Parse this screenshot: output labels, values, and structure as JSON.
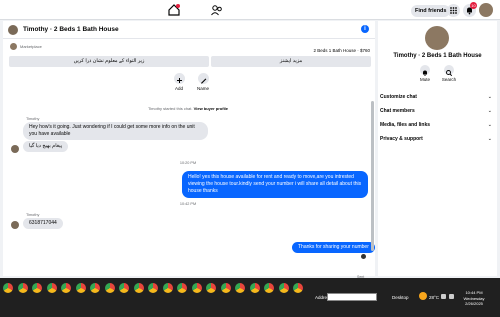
{
  "topnav": {
    "find_friends": "Find friends",
    "notification_count": "10"
  },
  "chat": {
    "contact": "Timothy · 2 Beds 1 Bath House",
    "marketplace_label": "Marketplace",
    "listing_summary": "2 Beds 1 Bath House · $760",
    "option_left": "زیر التواء کے معلوم نشان ذرا کریں",
    "option_right": "مزید اپشنز",
    "actions": [
      {
        "label": "Add",
        "icon": "plus-icon"
      },
      {
        "label": "Name",
        "icon": "pencil-icon"
      }
    ],
    "system_text": "Timothy started this chat.",
    "system_link": "View buyer profile",
    "messages": [
      {
        "sender": "Timothy",
        "text": "Hey how's it going. Just wondering if I could get some more info on the unit you have available",
        "direction": "in"
      },
      {
        "text": "پیغام بھیج دیا گیا",
        "direction": "in"
      },
      {
        "time": "10:20 PM"
      },
      {
        "text": "Hello! yes this house available for rent and ready to move,are you intrested viewing the house tour.kindly send your number i will share all detail about this house thanks",
        "direction": "out"
      },
      {
        "time": "10:42 PM"
      },
      {
        "sender": "Timothy",
        "text": "6318717044",
        "direction": "in"
      },
      {
        "text": "Thanks for sharing your number",
        "direction": "out"
      }
    ],
    "sent_status": "Sent",
    "composer_placeholder": "Aa"
  },
  "rpanel": {
    "name": "Timothy · 2 Beds 1 Bath House",
    "actions": [
      {
        "label": "Mute",
        "icon": "bell-icon"
      },
      {
        "label": "Search",
        "icon": "search-icon"
      }
    ],
    "sections": [
      "Customize chat",
      "Chat members",
      "Media, files and links",
      "Privacy & support"
    ]
  },
  "taskbar": {
    "address_label": "Address",
    "desktop_label": "Desktop",
    "temperature": "28°C",
    "time": "10:44 PM",
    "day": "Wednesday",
    "date": "2/26/2025"
  },
  "colors": {
    "accent": "#0866ff",
    "bubble_in": "#e4e6eb",
    "taskbar": "#202020"
  }
}
